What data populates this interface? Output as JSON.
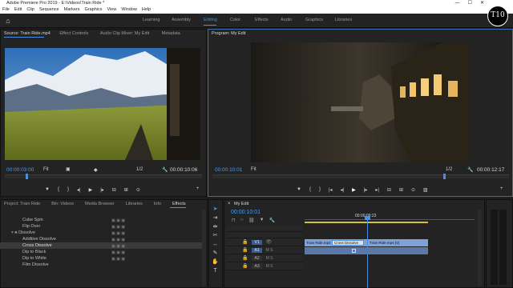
{
  "window": {
    "title": "Adobe Premiere Pro 2019 - E:\\Videos\\Train Ride *"
  },
  "menu": [
    "File",
    "Edit",
    "Clip",
    "Sequence",
    "Markers",
    "Graphics",
    "View",
    "Window",
    "Help"
  ],
  "workspaces": [
    "Learning",
    "Assembly",
    "Editing",
    "Color",
    "Effects",
    "Audio",
    "Graphics",
    "Libraries"
  ],
  "logo_text": "T10",
  "source": {
    "tabs": [
      "Source: Train Ride.mp4",
      "Effect Controls",
      "Audio Clip Mixer: My Edit",
      "Metadata"
    ],
    "timecode": "00:00:03:00",
    "fit": "Fit",
    "fraction": "1/2",
    "duration": "00:00:10:06"
  },
  "program": {
    "tab": "Program: My Edit",
    "timecode": "00:00:10:01",
    "fit": "Fit",
    "fraction": "1/2",
    "duration": "00:00:12:17"
  },
  "project": {
    "tabs": [
      "Project: Train Ride",
      "Bin: Videos",
      "Media Browser",
      "Libraries",
      "Info",
      "Effects"
    ],
    "rows": [
      "Cube Spin",
      "Flip Over",
      "Dissolve",
      "Additive Dissolve",
      "Cross Dissolve",
      "Dip to Black",
      "Dip to White",
      "Film Dissolve"
    ]
  },
  "timeline": {
    "tab": "My Edit",
    "timecode": "00:00:10:01",
    "ruler_time": "00:00:09:23",
    "tracks": [
      "V1",
      "A1",
      "A2",
      "A3"
    ],
    "clips": {
      "v1_left": "Train Ride.mp4 [V]",
      "transition": "Cross Dissolve",
      "v1_right": "Train Ride.mp4 [V]"
    }
  },
  "colors": {
    "accent": "#4a8fe0",
    "timecode": "#4a9cf0",
    "clip_video": "#7fa3d9",
    "clip_audio": "#5a79a8",
    "work_area": "#d4c13a"
  },
  "icons": [
    "home-icon",
    "play-icon",
    "step-back-icon",
    "step-forward-icon",
    "marker-icon",
    "export-frame-icon",
    "wrench-icon",
    "add-icon",
    "selection-tool-icon",
    "razor-tool-icon",
    "hand-tool-icon",
    "type-tool-icon"
  ]
}
